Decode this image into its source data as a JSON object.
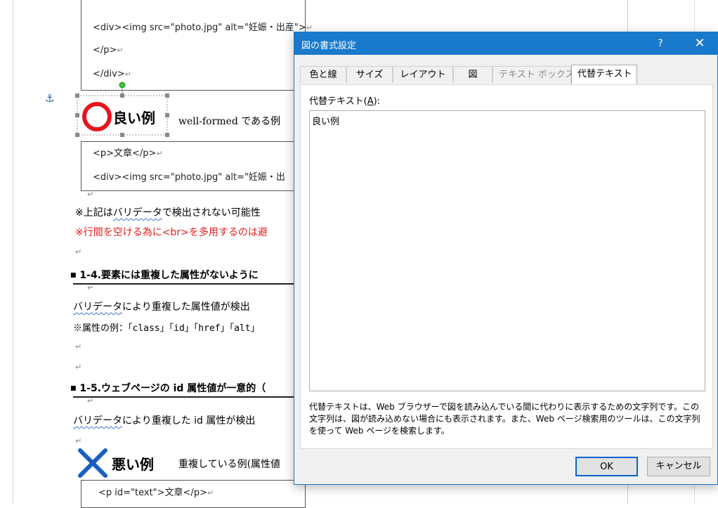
{
  "document": {
    "line1": "<div><img src=\"photo.jpg\" alt=\"妊娠・出産\">",
    "line2": "</p>",
    "line3": "</div>",
    "anchor_icon": "anchor-icon",
    "good_example": {
      "label": "良い例",
      "text": "well-formed である例",
      "code1": "<p>文章</p>",
      "code2": "<div><img src=\"photo.jpg\" alt=\"妊娠・出"
    },
    "note1_prefix": "※上記は",
    "note1_link": "バリデータ",
    "note1_rest": "で検出されない可能性",
    "note2": "※行間を空ける為に<br>を多用するのは避",
    "heading14": "1-4.要素には重複した属性がないように",
    "p14_link": "バリデータ",
    "p14_rest": "により重複した属性値が検出",
    "p14_note": "※属性の例：「class」「id」「href」「alt」",
    "heading15": "1-5.ウェブページの id 属性値が一意的（",
    "p15_link": "バリデータ",
    "p15_rest": "により重複した id 属性が検出",
    "bad_example": {
      "label": "悪い例",
      "text": "重複している例(属性値",
      "code1": "<p id=\"text\">文章</p>"
    },
    "return_mark": "↵"
  },
  "dialog": {
    "title": "図の書式設定",
    "help": "?",
    "close": "✕",
    "tabs": [
      "色と線",
      "サイズ",
      "レイアウト",
      "図",
      "テキスト ボックス",
      "代替テキスト"
    ],
    "active_tab": "代替テキスト",
    "alt_label_prefix": "代替テキスト(",
    "alt_label_key": "A",
    "alt_label_suffix": "):",
    "alt_text": "良い例",
    "description": "代替テキストは、Web ブラウザーで図を読み込んでいる間に代わりに表示するための文字列です。この文字列は、図が読み込めない場合にも表示されます。また、Web ページ検索用のツールは、この文字列を使って Web ページを検索します。",
    "ok": "OK",
    "cancel": "キャンセル"
  },
  "colors": {
    "accent": "#1979ca",
    "red_text": "#e31c1c",
    "good_circle": "#e8151c",
    "bad_cross": "#1a5fbf"
  }
}
